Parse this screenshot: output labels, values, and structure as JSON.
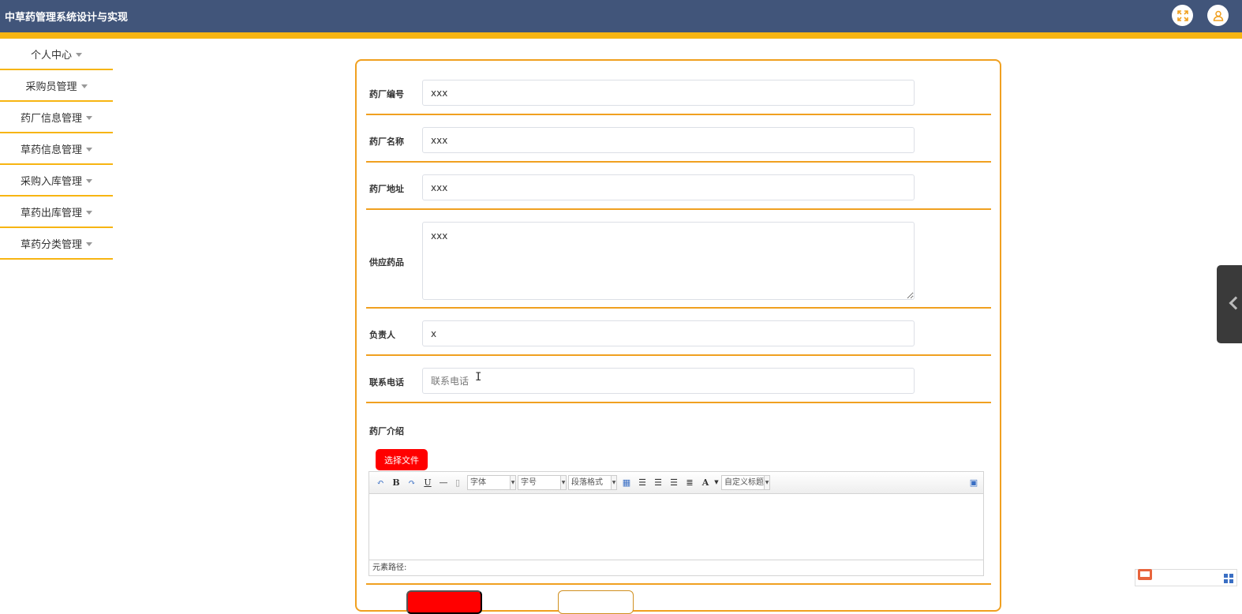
{
  "app": {
    "title": "中草药管理系统设计与实现"
  },
  "header": {
    "fullscreen_icon": "expand-icon",
    "user_icon": "user-icon",
    "accent": "#f7b512",
    "bar_color": "#41557a"
  },
  "sidebar": {
    "items": [
      {
        "label": "个人中心"
      },
      {
        "label": "采购员管理"
      },
      {
        "label": "药厂信息管理"
      },
      {
        "label": "草药信息管理"
      },
      {
        "label": "采购入库管理"
      },
      {
        "label": "草药出库管理"
      },
      {
        "label": "草药分类管理"
      }
    ]
  },
  "form": {
    "factory_code": {
      "label": "药厂编号",
      "value": "xxx"
    },
    "factory_name": {
      "label": "药厂名称",
      "value": "xxx"
    },
    "factory_address": {
      "label": "药厂地址",
      "value": "xxx"
    },
    "supply_drugs": {
      "label": "供应药品",
      "value": "xxx"
    },
    "person_in_charge": {
      "label": "负责人",
      "value": "x"
    },
    "phone": {
      "label": "联系电话",
      "value": "",
      "placeholder": "联系电话"
    },
    "intro": {
      "label": "药厂介绍"
    }
  },
  "upload": {
    "label": "选择文件"
  },
  "editor": {
    "font_family": "字体",
    "font_size": "字号",
    "paragraph": "段落格式",
    "custom_title": "自定义标题",
    "status": "元素路径:"
  }
}
